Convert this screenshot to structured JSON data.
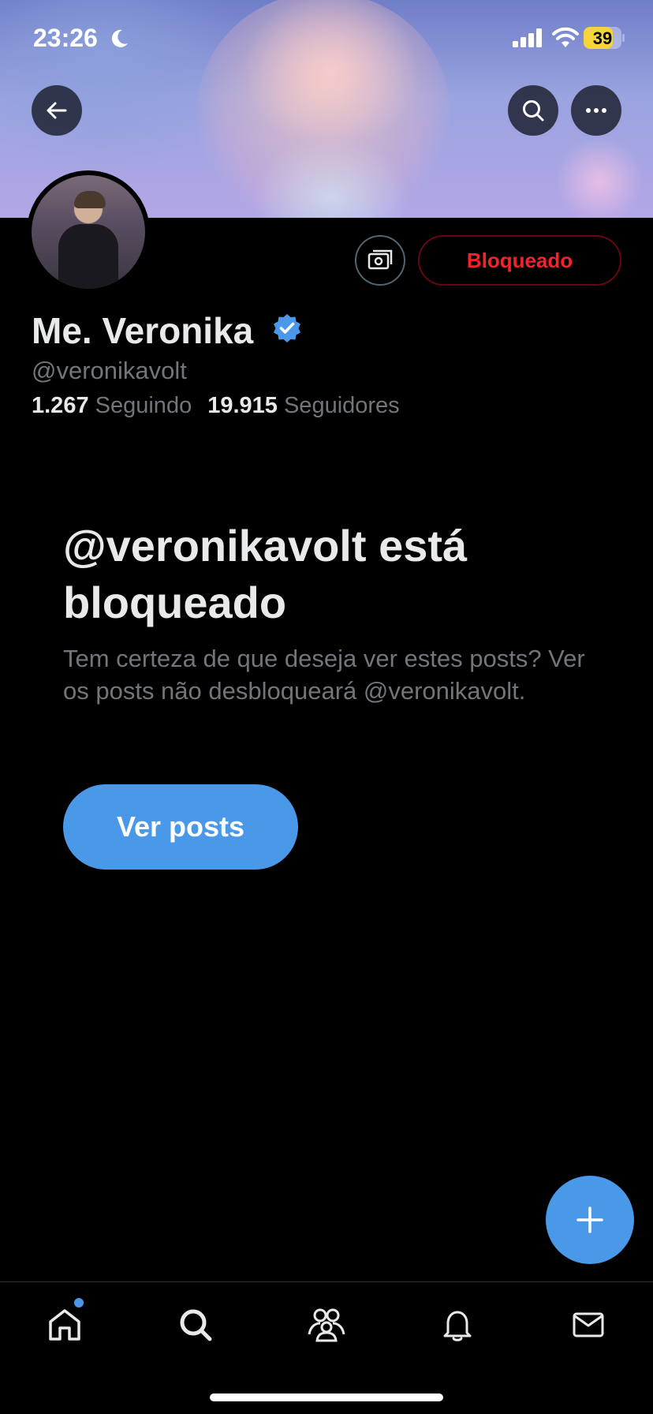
{
  "status_bar": {
    "time": "23:26",
    "battery_level": "39",
    "battery_color": "#f5d33a"
  },
  "profile": {
    "display_name": "Me. Veronika",
    "handle": "@veronikavolt",
    "verified": true,
    "following_count": "1.267",
    "following_label": "Seguindo",
    "followers_count": "19.915",
    "followers_label": "Seguidores",
    "blocked_button_label": "Bloqueado"
  },
  "blocked_notice": {
    "title": "@veronikavolt está bloqueado",
    "description": "Tem certeza de que deseja ver estes posts? Ver os posts não desbloqueará @veronikavolt.",
    "button_label": "Ver posts"
  },
  "nav": {
    "items": [
      "home-icon",
      "search-icon",
      "communities-icon",
      "notifications-icon",
      "messages-icon"
    ],
    "active": "home-icon"
  },
  "colors": {
    "accent": "#4a99e9",
    "blocked_red": "#f4212e",
    "verified_blue": "#4a99e9",
    "muted_text": "#71767b"
  }
}
